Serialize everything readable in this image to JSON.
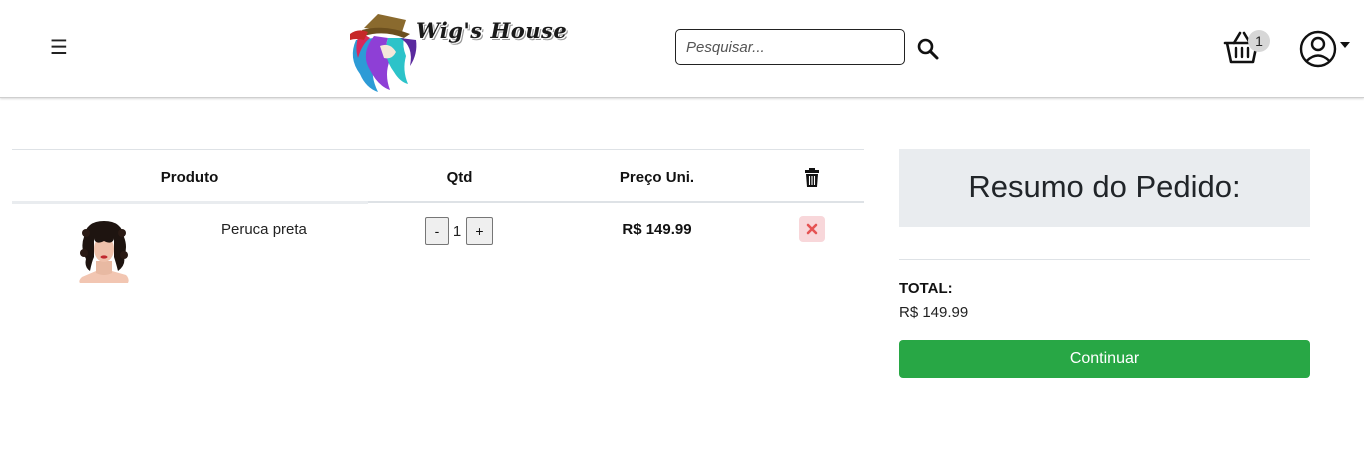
{
  "header": {
    "menu_icon": "hamburger-icon",
    "logo_text": "Wig's House",
    "search": {
      "placeholder": "Pesquisar...",
      "value": "",
      "icon": "search-icon"
    },
    "cart": {
      "icon": "basket-icon",
      "count": "1"
    },
    "user": {
      "icon": "user-circle-icon",
      "dropdown_icon": "caret-down-icon"
    }
  },
  "cart_table": {
    "columns": {
      "produto": "Produto",
      "qtd": "Qtd",
      "preco": "Preço Uni.",
      "remove_icon": "trash-icon"
    },
    "items": [
      {
        "name": "Peruca preta",
        "quantity": "1",
        "minus_label": "-",
        "plus_label": "+",
        "price": "R$ 149.99",
        "remove_icon": "close-x-icon"
      }
    ]
  },
  "summary": {
    "title": "Resumo do Pedido:",
    "total_label": "TOTAL:",
    "total_value": "R$ 149.99",
    "continue_label": "Continuar"
  },
  "colors": {
    "accent_green": "#28a745",
    "summary_bg": "#e9ecef",
    "remove_bg": "#f8d7da",
    "remove_icon": "#e55353",
    "badge_bg": "#d7d7d7"
  }
}
